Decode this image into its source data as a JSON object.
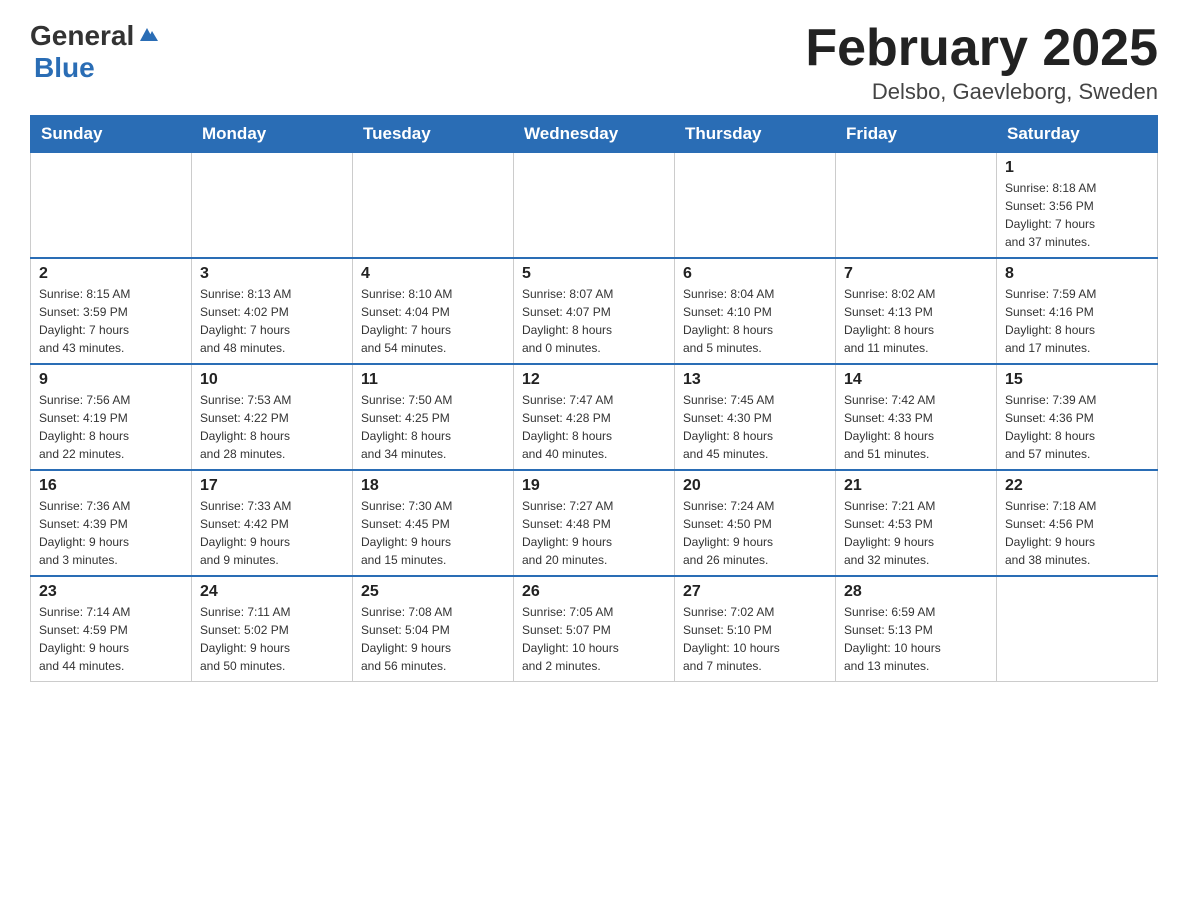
{
  "header": {
    "logo_general": "General",
    "logo_blue": "Blue",
    "title": "February 2025",
    "subtitle": "Delsbo, Gaevleborg, Sweden"
  },
  "weekdays": [
    "Sunday",
    "Monday",
    "Tuesday",
    "Wednesday",
    "Thursday",
    "Friday",
    "Saturday"
  ],
  "weeks": [
    [
      {
        "day": "",
        "info": ""
      },
      {
        "day": "",
        "info": ""
      },
      {
        "day": "",
        "info": ""
      },
      {
        "day": "",
        "info": ""
      },
      {
        "day": "",
        "info": ""
      },
      {
        "day": "",
        "info": ""
      },
      {
        "day": "1",
        "info": "Sunrise: 8:18 AM\nSunset: 3:56 PM\nDaylight: 7 hours\nand 37 minutes."
      }
    ],
    [
      {
        "day": "2",
        "info": "Sunrise: 8:15 AM\nSunset: 3:59 PM\nDaylight: 7 hours\nand 43 minutes."
      },
      {
        "day": "3",
        "info": "Sunrise: 8:13 AM\nSunset: 4:02 PM\nDaylight: 7 hours\nand 48 minutes."
      },
      {
        "day": "4",
        "info": "Sunrise: 8:10 AM\nSunset: 4:04 PM\nDaylight: 7 hours\nand 54 minutes."
      },
      {
        "day": "5",
        "info": "Sunrise: 8:07 AM\nSunset: 4:07 PM\nDaylight: 8 hours\nand 0 minutes."
      },
      {
        "day": "6",
        "info": "Sunrise: 8:04 AM\nSunset: 4:10 PM\nDaylight: 8 hours\nand 5 minutes."
      },
      {
        "day": "7",
        "info": "Sunrise: 8:02 AM\nSunset: 4:13 PM\nDaylight: 8 hours\nand 11 minutes."
      },
      {
        "day": "8",
        "info": "Sunrise: 7:59 AM\nSunset: 4:16 PM\nDaylight: 8 hours\nand 17 minutes."
      }
    ],
    [
      {
        "day": "9",
        "info": "Sunrise: 7:56 AM\nSunset: 4:19 PM\nDaylight: 8 hours\nand 22 minutes."
      },
      {
        "day": "10",
        "info": "Sunrise: 7:53 AM\nSunset: 4:22 PM\nDaylight: 8 hours\nand 28 minutes."
      },
      {
        "day": "11",
        "info": "Sunrise: 7:50 AM\nSunset: 4:25 PM\nDaylight: 8 hours\nand 34 minutes."
      },
      {
        "day": "12",
        "info": "Sunrise: 7:47 AM\nSunset: 4:28 PM\nDaylight: 8 hours\nand 40 minutes."
      },
      {
        "day": "13",
        "info": "Sunrise: 7:45 AM\nSunset: 4:30 PM\nDaylight: 8 hours\nand 45 minutes."
      },
      {
        "day": "14",
        "info": "Sunrise: 7:42 AM\nSunset: 4:33 PM\nDaylight: 8 hours\nand 51 minutes."
      },
      {
        "day": "15",
        "info": "Sunrise: 7:39 AM\nSunset: 4:36 PM\nDaylight: 8 hours\nand 57 minutes."
      }
    ],
    [
      {
        "day": "16",
        "info": "Sunrise: 7:36 AM\nSunset: 4:39 PM\nDaylight: 9 hours\nand 3 minutes."
      },
      {
        "day": "17",
        "info": "Sunrise: 7:33 AM\nSunset: 4:42 PM\nDaylight: 9 hours\nand 9 minutes."
      },
      {
        "day": "18",
        "info": "Sunrise: 7:30 AM\nSunset: 4:45 PM\nDaylight: 9 hours\nand 15 minutes."
      },
      {
        "day": "19",
        "info": "Sunrise: 7:27 AM\nSunset: 4:48 PM\nDaylight: 9 hours\nand 20 minutes."
      },
      {
        "day": "20",
        "info": "Sunrise: 7:24 AM\nSunset: 4:50 PM\nDaylight: 9 hours\nand 26 minutes."
      },
      {
        "day": "21",
        "info": "Sunrise: 7:21 AM\nSunset: 4:53 PM\nDaylight: 9 hours\nand 32 minutes."
      },
      {
        "day": "22",
        "info": "Sunrise: 7:18 AM\nSunset: 4:56 PM\nDaylight: 9 hours\nand 38 minutes."
      }
    ],
    [
      {
        "day": "23",
        "info": "Sunrise: 7:14 AM\nSunset: 4:59 PM\nDaylight: 9 hours\nand 44 minutes."
      },
      {
        "day": "24",
        "info": "Sunrise: 7:11 AM\nSunset: 5:02 PM\nDaylight: 9 hours\nand 50 minutes."
      },
      {
        "day": "25",
        "info": "Sunrise: 7:08 AM\nSunset: 5:04 PM\nDaylight: 9 hours\nand 56 minutes."
      },
      {
        "day": "26",
        "info": "Sunrise: 7:05 AM\nSunset: 5:07 PM\nDaylight: 10 hours\nand 2 minutes."
      },
      {
        "day": "27",
        "info": "Sunrise: 7:02 AM\nSunset: 5:10 PM\nDaylight: 10 hours\nand 7 minutes."
      },
      {
        "day": "28",
        "info": "Sunrise: 6:59 AM\nSunset: 5:13 PM\nDaylight: 10 hours\nand 13 minutes."
      },
      {
        "day": "",
        "info": ""
      }
    ]
  ]
}
